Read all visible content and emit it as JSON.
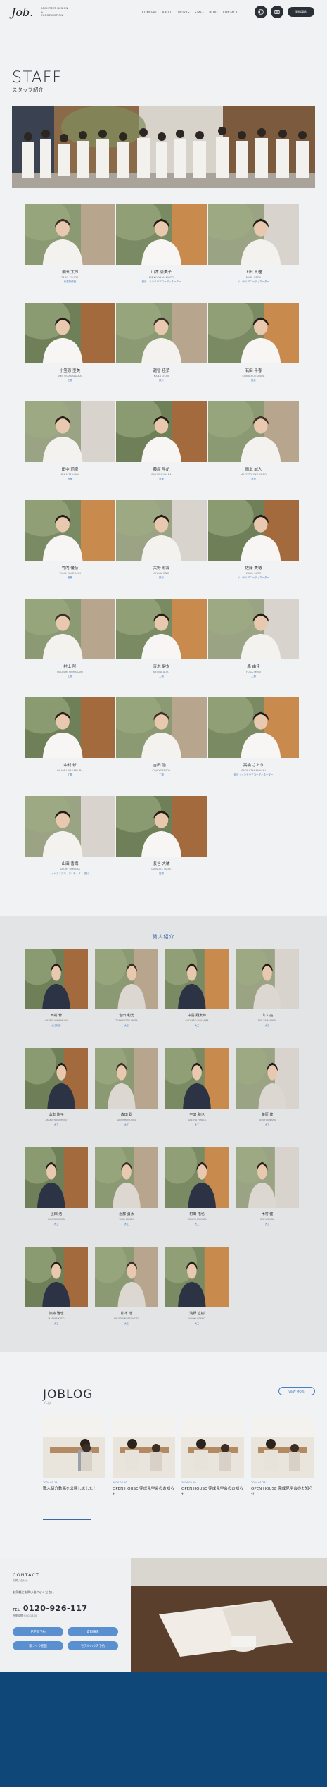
{
  "header": {
    "logo": "Job.",
    "logo_sub_1": "ARCHITECT DESIGN",
    "logo_sub_2": "&",
    "logo_sub_3": "CONSTRUCTION",
    "nav": [
      "CONCEPT",
      "ABOUT",
      "WORKS",
      "STAFF",
      "BLOG",
      "CONTACT"
    ],
    "icon_1": "instagram-icon",
    "icon_2": "mail-icon",
    "cta": "資料請求"
  },
  "page": {
    "title": "STAFF",
    "subtitle": "スタッフ紹介"
  },
  "staff": [
    {
      "name": "津田 太郎",
      "en": "TARO TSUDA",
      "role": "代表取締役"
    },
    {
      "name": "山本 恵美子",
      "en": "EMIKO YAMAMOTO",
      "role": "設計・インテリアコーディネーター"
    },
    {
      "name": "上田 真理",
      "en": "MARI UEDA",
      "role": "インテリアコーディネーター"
    },
    {
      "name": "小笠原 亜美",
      "en": "AMI OGASAWARA",
      "role": "工務"
    },
    {
      "name": "越智 佳菜",
      "en": "KANA OCHI",
      "role": "設計"
    },
    {
      "name": "石田 千春",
      "en": "CHIHARU ISHIDA",
      "role": "設計"
    },
    {
      "name": "田中 莉奈",
      "en": "RINA TANAKA",
      "role": "営業"
    },
    {
      "name": "藤原 早紀",
      "en": "SAKI FUJIWARA",
      "role": "営業"
    },
    {
      "name": "岡本 誠人",
      "en": "MAKOTO OKAMOTO",
      "role": "営業"
    },
    {
      "name": "竹内 優奈",
      "en": "YUNA TAKEUCHI",
      "role": "営業"
    },
    {
      "name": "大野 彩加",
      "en": "AYAKA ONO",
      "role": "設計"
    },
    {
      "name": "佐藤 美穂",
      "en": "MIHO SATO",
      "role": "インテリアコーディネーター"
    },
    {
      "name": "村上 隆",
      "en": "TAKASHI MURAKAMI",
      "role": "工務"
    },
    {
      "name": "青木 健太",
      "en": "KENTA AOKI",
      "role": "工務"
    },
    {
      "name": "森 由佳",
      "en": "YUKA MORI",
      "role": "工務"
    },
    {
      "name": "中村 修",
      "en": "OSAMU NAKAMURA",
      "role": "工務"
    },
    {
      "name": "吉田 浩二",
      "en": "KOJI YOSHIDA",
      "role": "工務"
    },
    {
      "name": "高橋 さおり",
      "en": "SAORI TAKAHASHI",
      "role": "設計・インテリアコーディネーター"
    },
    {
      "name": "山田 香織",
      "en": "KAORI YAMADA",
      "role": "インテリアコーディネーター 設計"
    },
    {
      "name": "長谷 大輔",
      "en": "DAISUKE HASE",
      "role": "営業"
    }
  ],
  "artisans_title": "職人紹介",
  "artisans": [
    {
      "name": "西村 修",
      "en": "OSAMU NISHIMURA",
      "role": "大工棟梁"
    },
    {
      "name": "岩田 利光",
      "en": "TOSHIMITSU IWATA",
      "role": "大工"
    },
    {
      "name": "中島 翔太郎",
      "en": "SHOTARO NAKAJIMA",
      "role": "大工"
    },
    {
      "name": "山下 亮",
      "en": "RYO YAMASHITA",
      "role": "大工"
    },
    {
      "name": "山本 絢子",
      "en": "AYAKO YAMAMOTO",
      "role": "大工"
    },
    {
      "name": "森田 聡",
      "en": "SATOSHI MORITA",
      "role": "大工"
    },
    {
      "name": "平田 和也",
      "en": "KAZUYA HIRATA",
      "role": "大工"
    },
    {
      "name": "藤原 健",
      "en": "KEN FUJIWARA",
      "role": "大工"
    },
    {
      "name": "上田 浩",
      "en": "HIROSHI UEDA",
      "role": "大工"
    },
    {
      "name": "近藤 勇太",
      "en": "YUTA KONDO",
      "role": "大工"
    },
    {
      "name": "村田 拓也",
      "en": "TAKUYA MURATA",
      "role": "大工"
    },
    {
      "name": "木村 健",
      "en": "KEN KIMURA",
      "role": "大工"
    },
    {
      "name": "加藤 雅也",
      "en": "MASAYA KATO",
      "role": "大工"
    },
    {
      "name": "松本 浩",
      "en": "HIROSHI MATSUMOTO",
      "role": "大工"
    },
    {
      "name": "浅野 直樹",
      "en": "NAOKI ASANO",
      "role": "大工"
    }
  ],
  "blog": {
    "title": "JOBLOG",
    "subtitle": "ブログ",
    "more": "VIEW MORE",
    "posts": [
      {
        "date": "2024.03.15",
        "title": "職人紹介動画を公開しました！"
      },
      {
        "date": "2024.02.20",
        "title": "OPEN HOUSE 完成見学会のお知らせ"
      },
      {
        "date": "2024.02.10",
        "title": "OPEN HOUSE 完成見学会のお知らせ"
      },
      {
        "date": "2024.01.28",
        "title": "OPEN HOUSE 完成見学会のお知らせ"
      }
    ]
  },
  "contact": {
    "heading": "CONTACT",
    "sub": "お問い合わせ",
    "text": "お気軽にお問い合わせください",
    "tel": "0120-926-117",
    "tel_prefix": "TEL",
    "hours": "営業時間 9:00-18:00",
    "buttons": [
      "見学会予約",
      "資料請求",
      "家づくり相談",
      "モデルハウス予約"
    ]
  },
  "colors": {
    "accent": "#4a7fc4",
    "dark": "#2b2f36",
    "footer": "#0f4778"
  }
}
